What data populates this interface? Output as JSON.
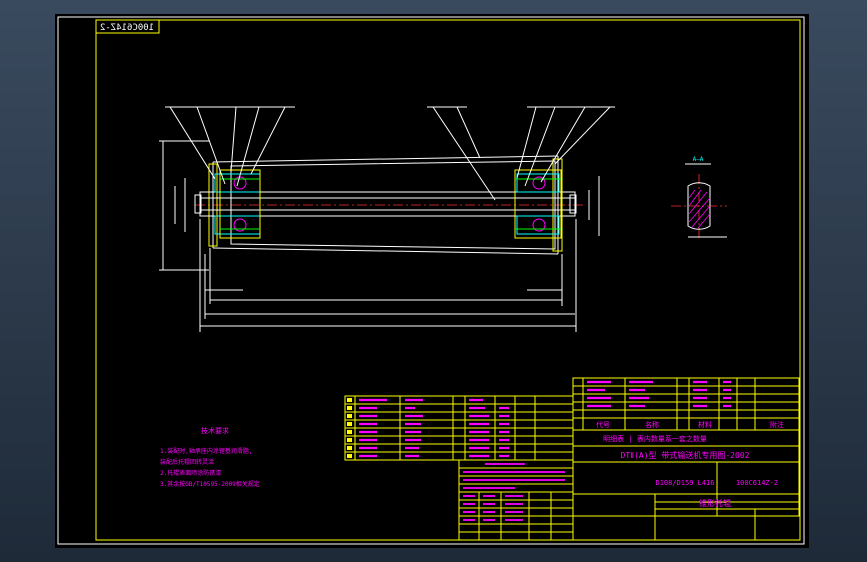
{
  "drawing_number_mirrored": "100C614Z-2",
  "section_label": "A—A",
  "tech_requirements": {
    "title": "技术要求",
    "lines": [
      "1.装配时,轴承座内涂锂基润滑脂,",
      "  装配后托辊回转灵活",
      "2.托辊表面喷涂防锈漆",
      "3.其余按GB/T10595-2009相关规定"
    ]
  },
  "title_block": {
    "standard_line": "DTⅡ(A)型 带式输送机专用图-2002",
    "model": "D108/D159 L416",
    "drawing_number": "100C614Z-2",
    "part_name": "锥形托辊",
    "header_cells": [
      "代号",
      "名称",
      "材料",
      "附注"
    ],
    "note_line": "明细表 | 表内数量系一套之数量"
  }
}
